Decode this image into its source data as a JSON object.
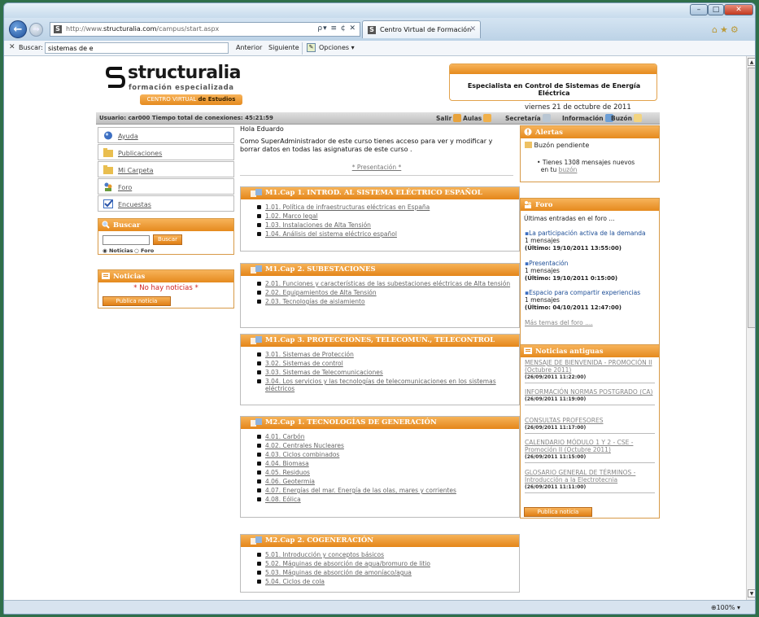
{
  "browser": {
    "url_prefix": "http://www.",
    "url_domain": "structuralia.com",
    "url_path": "/campus/start.aspx",
    "addr_tools": "ρ▾ ≡ ¢ ✕",
    "tab_title": "Centro Virtual de Formación",
    "zoom": "100%",
    "find": {
      "label": "Buscar:",
      "value": "sistemas de e",
      "prev": "Anterior",
      "next": "Siguiente",
      "options": "Opciones ▾"
    }
  },
  "header": {
    "logo": "structuralia",
    "tagline": "formación especializada",
    "badge_a": "CENTRO VIRTUAL",
    "badge_b": "de Estudios",
    "spec_title": "Especialista en Control de Sistemas de Energía Eléctrica",
    "date": "viernes 21 de octubre de 2011"
  },
  "userbar": {
    "info": "Usuario: car000   Tiempo total de conexiones: 45:21:59",
    "links": [
      "Salir",
      "Aulas",
      "Secretaría",
      "Información",
      "Buzón"
    ]
  },
  "left_nav": [
    "Ayuda",
    "Publicaciones",
    "Mi Carpeta",
    "Foro",
    "Encuestas"
  ],
  "search": {
    "title": "Buscar",
    "button": "Buscar",
    "opt1": "Noticias",
    "opt2": "Foro"
  },
  "noticias": {
    "title": "Noticias",
    "empty": "* No hay noticias *",
    "button": "Publica noticia"
  },
  "center": {
    "greeting": "Hola Eduardo",
    "admin_msg": "Como SuperAdministrador de este curso tienes acceso para ver y modificar y borrar datos en todas las asignaturas de este curso .",
    "presentacion": "* Presentación *",
    "modules": [
      {
        "title": "M1.Cap 1. INTROD. AL SISTEMA ELÉCTRICO ESPAÑOL",
        "items": [
          "1.01. Política de infraestructuras eléctricas en España",
          "1.02. Marco legal",
          "1.03. Instalaciones de Alta Tensión",
          "1.04. Análisis del sistema eléctrico español"
        ]
      },
      {
        "title": "M1.Cap 2. SUBESTACIONES",
        "items": [
          "2.01. Funciones y características de las subestaciones eléctricas de Alta tensión",
          "2.02. Equipamientos de Alta Tensión",
          "2.03. Tecnologías de aislamiento"
        ]
      },
      {
        "title": "M1.Cap 3. PROTECCIONES, TELECOMUN., TELECONTROL",
        "items": [
          "3.01. Sistemas de Protección",
          "3.02. Sistemas de control",
          "3.03. Sistemas de Telecomunicaciones",
          "3.04. Los servicios y las tecnologías de telecomunicaciones en los sistemas eléctricos"
        ]
      },
      {
        "title": "M2.Cap 1. TECNOLOGÍAS DE GENERACIÓN",
        "items": [
          "4.01. Carbón",
          "4.02. Centrales Nucleares",
          "4.03. Ciclos combinados",
          "4.04. Biomasa",
          "4.05. Residuos",
          "4.06. Geotermia",
          "4.07. Energías del mar. Energía de las olas, mares y corrientes",
          "4.08. Eólica"
        ]
      },
      {
        "title": "M2.Cap 2. COGENERACIÓN",
        "items": [
          "5.01. Introducción y conceptos básicos",
          "5.02. Máquinas de absorción de agua/bromuro de litio",
          "5.03. Máquinas de absorción de amoníaco/agua",
          "5.04. Ciclos de cola"
        ]
      }
    ]
  },
  "alertas": {
    "title": "Alertas",
    "buzon": "Buzón pendiente",
    "msg_a": "Tienes 1308 mensajes nuevos",
    "msg_b": "en tu",
    "msg_link": "buzón"
  },
  "foro": {
    "title": "Foro",
    "intro": "Últimas entradas en el foro ...",
    "entries": [
      {
        "title": "La participación activa de la demanda",
        "count": "1 mensajes",
        "last": "(Último: 19/10/2011 13:55:00)"
      },
      {
        "title": "Presentación",
        "count": "1 mensajes",
        "last": "(Último: 19/10/2011 0:15:00)"
      },
      {
        "title": "Espacio para compartir experiencias",
        "count": "1 mensajes",
        "last": "(Último: 04/10/2011 12:47:00)"
      }
    ],
    "more": "Más temas del foro ...."
  },
  "noticias_antiguas": {
    "title": "Noticias antiguas",
    "items": [
      {
        "title": "MENSAJE DE BIENVENIDA - PROMOCIÓN II (Octubre 2011)",
        "date": "(26/09/2011 11:22:00)"
      },
      {
        "title": "INFORMACIÓN NORMAS POSTGRADO (CA)",
        "date": "(26/09/2011 11:19:00)"
      },
      {
        "title": "CONSULTAS PROFESORES",
        "date": "(26/09/2011 11:17:00)"
      },
      {
        "title": "CALENDARIO MÓDULO 1 Y 2 - CSE - Promoción II (Octubre 2011)",
        "date": "(26/09/2011 11:15:00)"
      },
      {
        "title": "GLOSARIO GENERAL DE TÉRMINOS - Introducción a la Electrotecnia",
        "date": "(26/09/2011 11:11:00)"
      }
    ],
    "button": "Publica noticia"
  }
}
